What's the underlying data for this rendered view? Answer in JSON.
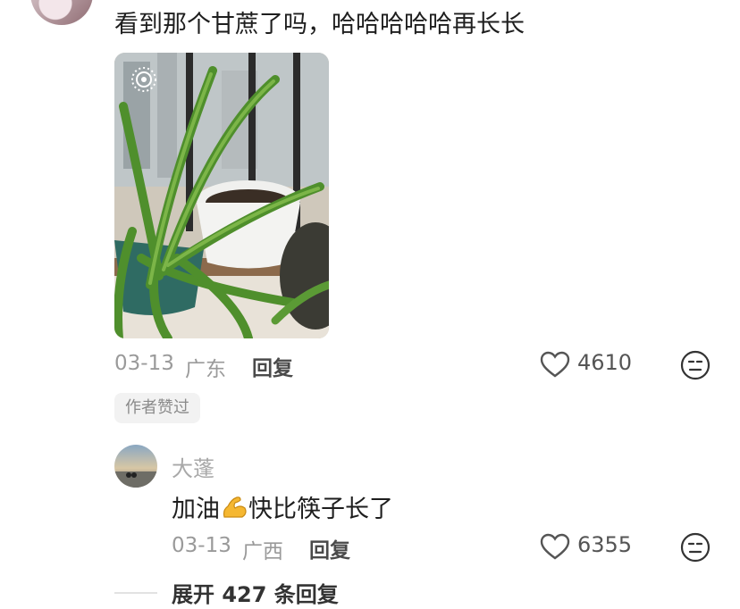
{
  "comment": {
    "text": "看到那个甘蔗了吗，哈哈哈哈哈再长长",
    "date": "03-13",
    "location": "广东",
    "reply_label": "回复",
    "likes": "4610",
    "badge": "作者赞过"
  },
  "sub_comment": {
    "username": "大蓬",
    "text_before": "加油",
    "emoji": "flexed-biceps-emoji",
    "text_after": "快比筷子长了",
    "date": "03-13",
    "location": "广西",
    "reply_label": "回复",
    "likes": "6355"
  },
  "expand": {
    "label": "展开 427 条回复"
  },
  "colors": {
    "meta_gray": "#9a9a9a",
    "badge_bg": "#f2f2f2",
    "text": "#1e1e1e"
  }
}
